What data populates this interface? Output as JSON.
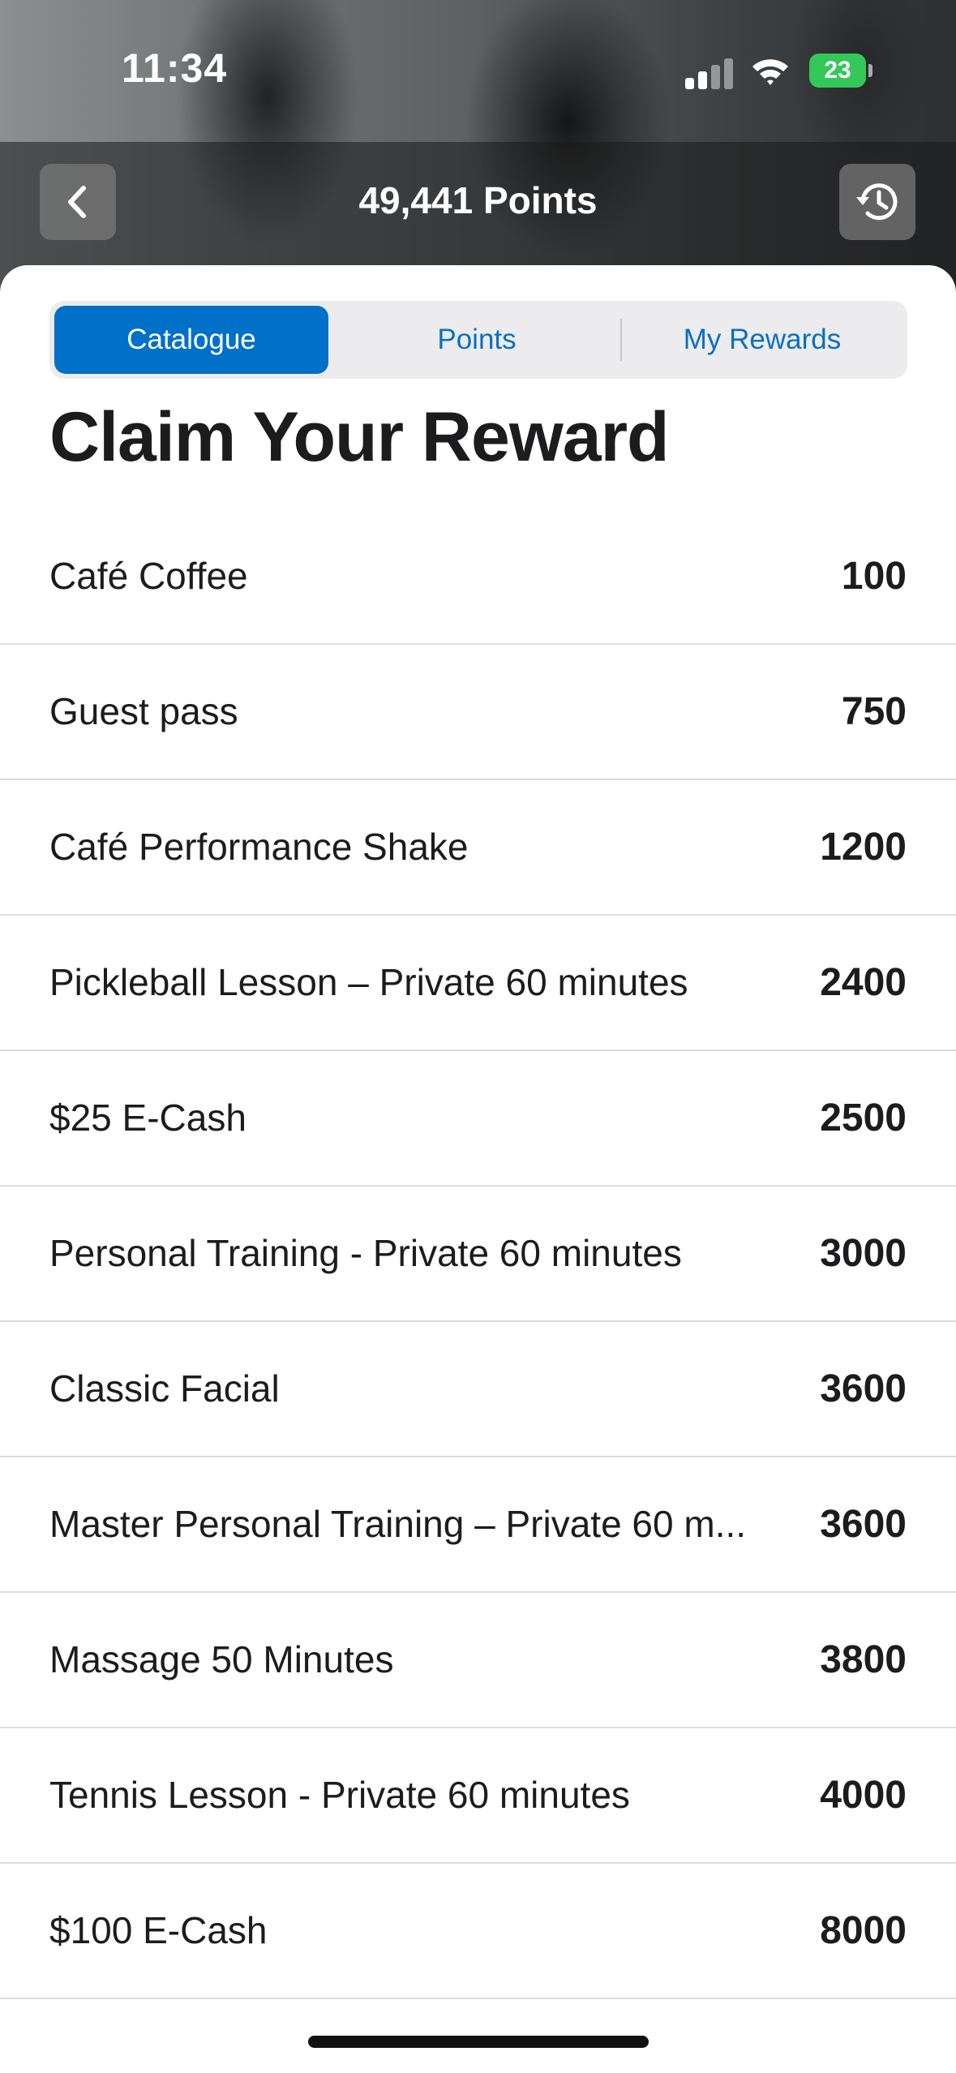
{
  "status_bar": {
    "time": "11:34",
    "battery_level": "23"
  },
  "header": {
    "title": "49,441 Points",
    "back_icon": "chevron-left-icon",
    "history_icon": "history-icon"
  },
  "tabs": [
    {
      "label": "Catalogue",
      "active": true
    },
    {
      "label": "Points",
      "active": false
    },
    {
      "label": "My Rewards",
      "active": false
    }
  ],
  "page_title": "Claim Your Reward",
  "rewards": [
    {
      "name": "Café Coffee",
      "points": "100"
    },
    {
      "name": "Guest pass",
      "points": "750"
    },
    {
      "name": "Café Performance Shake",
      "points": "1200"
    },
    {
      "name": "Pickleball Lesson – Private 60 minutes",
      "points": "2400"
    },
    {
      "name": "$25 E-Cash",
      "points": "2500"
    },
    {
      "name": "Personal Training - Private 60 minutes",
      "points": "3000"
    },
    {
      "name": "Classic Facial",
      "points": "3600"
    },
    {
      "name": "Master Personal Training – Private 60 m...",
      "points": "3600"
    },
    {
      "name": "Massage 50 Minutes",
      "points": "3800"
    },
    {
      "name": "Tennis Lesson - Private 60 minutes",
      "points": "4000"
    },
    {
      "name": "$100 E-Cash",
      "points": "8000"
    }
  ],
  "colors": {
    "accent": "#0070c9",
    "battery": "#34c759"
  }
}
